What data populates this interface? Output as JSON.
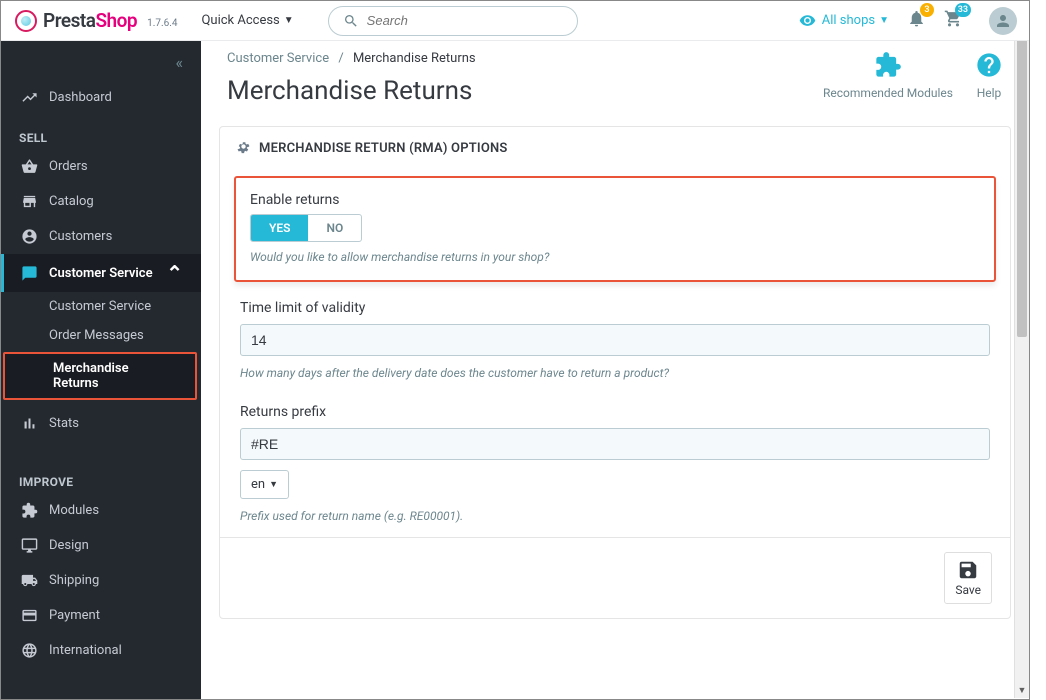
{
  "header": {
    "brand_presta": "Presta",
    "brand_shop": "Shop",
    "version": "1.7.6.4",
    "quick_access": "Quick Access",
    "search_placeholder": "Search",
    "shop_selector": "All shops",
    "notif_badge": "3",
    "cart_badge": "33"
  },
  "sidebar": {
    "dashboard": "Dashboard",
    "section_sell": "SELL",
    "orders": "Orders",
    "catalog": "Catalog",
    "customers": "Customers",
    "customer_service": "Customer Service",
    "sub_customer_service": "Customer Service",
    "sub_order_messages": "Order Messages",
    "sub_merchandise_returns": "Merchandise Returns",
    "stats": "Stats",
    "section_improve": "IMPROVE",
    "modules": "Modules",
    "design": "Design",
    "shipping": "Shipping",
    "payment": "Payment",
    "international": "International"
  },
  "breadcrumb": {
    "parent": "Customer Service",
    "current": "Merchandise Returns"
  },
  "page_title": "Merchandise Returns",
  "actions": {
    "recommended": "Recommended Modules",
    "help": "Help"
  },
  "panel": {
    "title": "MERCHANDISE RETURN (RMA) OPTIONS",
    "enable_returns_label": "Enable returns",
    "yes": "YES",
    "no": "NO",
    "enable_returns_help": "Would you like to allow merchandise returns in your shop?",
    "time_limit_label": "Time limit of validity",
    "time_limit_value": "14",
    "time_limit_help": "How many days after the delivery date does the customer have to return a product?",
    "prefix_label": "Returns prefix",
    "prefix_value": "#RE",
    "lang": "en",
    "prefix_help": "Prefix used for return name (e.g. RE00001).",
    "save": "Save"
  }
}
